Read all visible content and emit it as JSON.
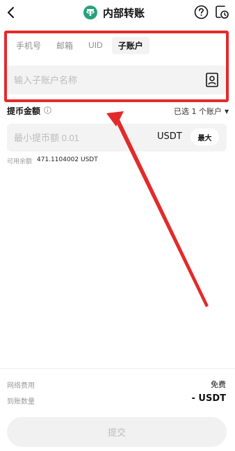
{
  "header": {
    "title": "内部转账",
    "coin_icon": "usdt-tether-icon",
    "back_icon": "chevron-left-icon",
    "help_icon": "help-circle-icon",
    "history_icon": "history-clock-icon"
  },
  "tabs": [
    {
      "label": "手机号",
      "active": false
    },
    {
      "label": "邮箱",
      "active": false
    },
    {
      "label": "UID",
      "active": false
    },
    {
      "label": "子账户",
      "active": true
    }
  ],
  "subaccount": {
    "placeholder": "输入子账户名称",
    "value": "",
    "contact_icon": "contact-book-icon"
  },
  "amount": {
    "label": "提币金额",
    "account_select": "已选 1 个账户",
    "placeholder": "最小提币额 0.01",
    "unit": "USDT",
    "max_label": "最大",
    "balance_label": "可用余额",
    "balance_value": "471.1104002 USDT"
  },
  "footer": {
    "fee_label": "网络费用",
    "fee_value": "免费",
    "recv_label": "到账数量",
    "recv_value": "- USDT",
    "submit_label": "提交"
  },
  "colors": {
    "accent_green": "#26a17b",
    "highlight_red": "#e32a2a",
    "field_bg": "#f3f3f3"
  }
}
